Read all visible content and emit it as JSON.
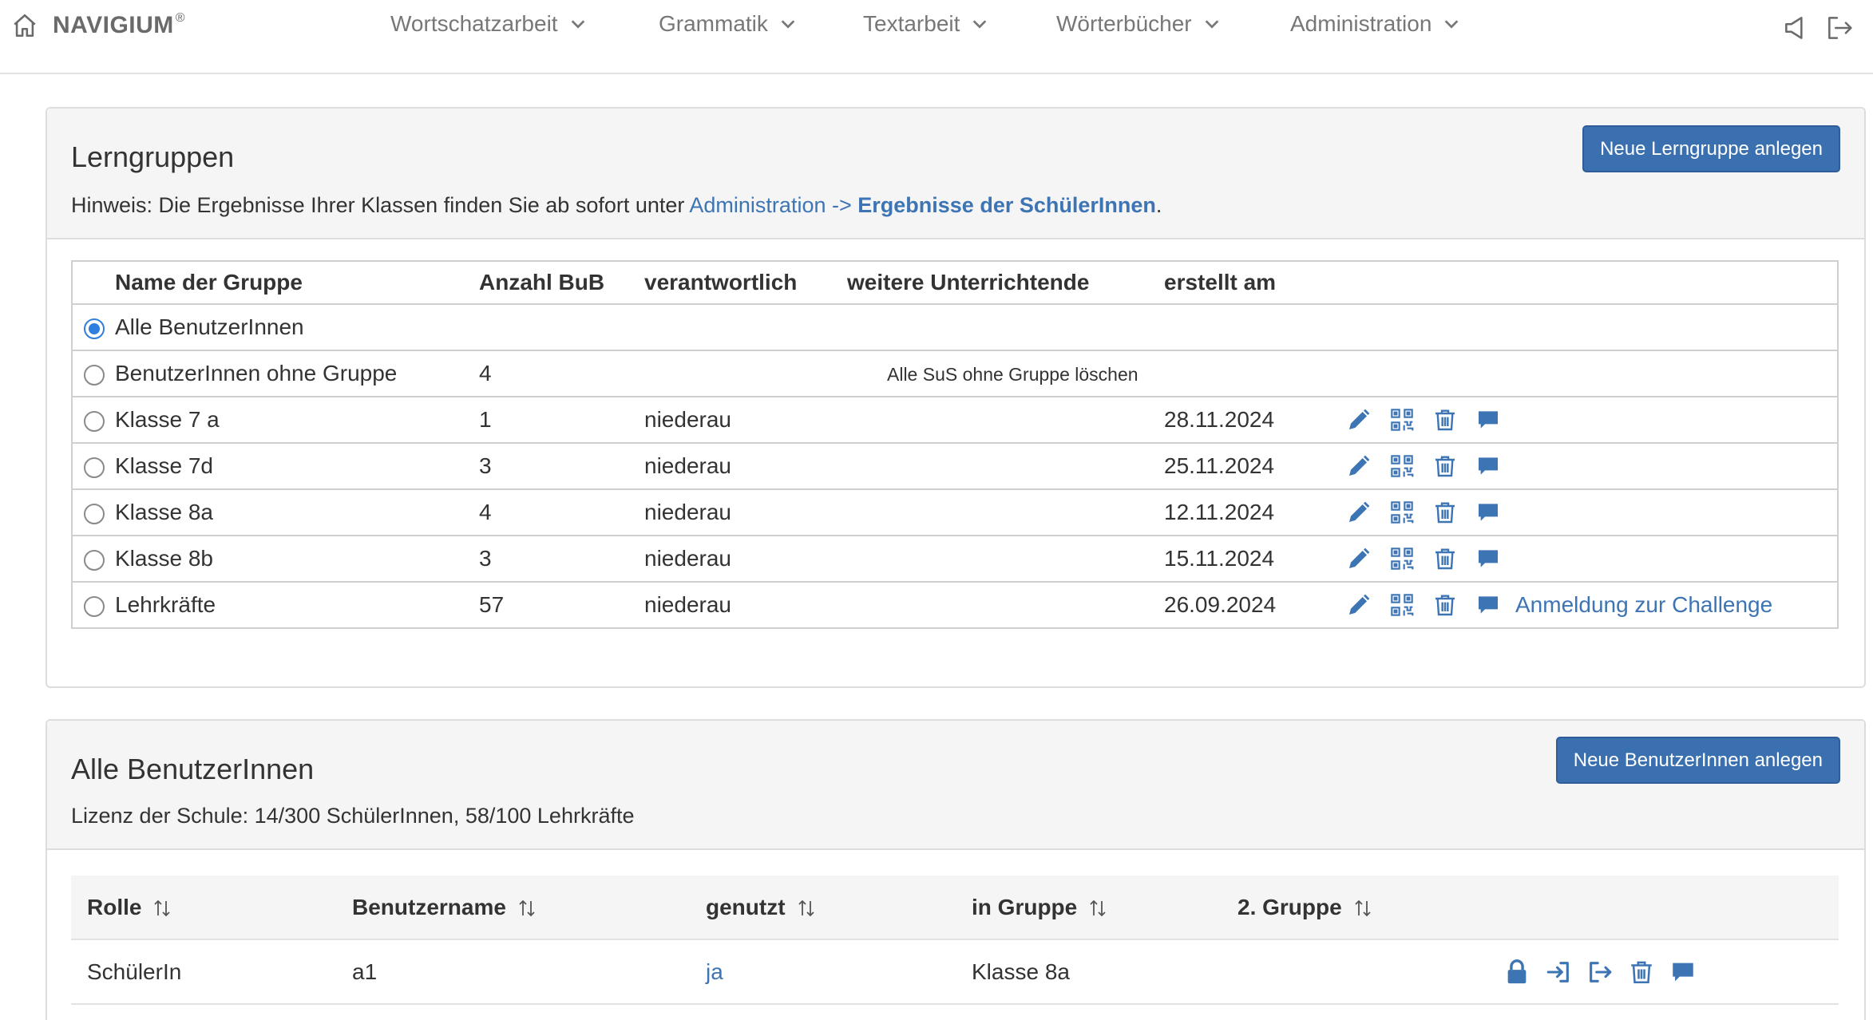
{
  "navbar": {
    "brand": "NAVIGIUM",
    "brand_mark": "®",
    "home_icon": "home-icon",
    "menu": [
      {
        "label": "Wortschatzarbeit"
      },
      {
        "label": "Grammatik"
      },
      {
        "label": "Textarbeit"
      },
      {
        "label": "Wörterbücher"
      },
      {
        "label": "Administration"
      }
    ],
    "right_icons": [
      "speaker-icon",
      "logout-icon"
    ]
  },
  "groups": {
    "title": "Lerngruppen",
    "new_button": "Neue Lerngruppe anlegen",
    "hint_prefix": "Hinweis: Die Ergebnisse Ihrer Klassen finden Sie ab sofort unter ",
    "hint_link1": "Administration ->",
    "hint_link2": "Ergebnisse der SchülerInnen",
    "hint_suffix": ".",
    "headers": {
      "name": "Name der Gruppe",
      "count": "Anzahl BuB",
      "responsible": "verantwortlich",
      "more_teachers": "weitere Unterrichtende",
      "created": "erstellt am"
    },
    "row_all": {
      "name": "Alle BenutzerInnen",
      "selected": true
    },
    "row_nogroup": {
      "name": "BenutzerInnen ohne Gruppe",
      "count": "4",
      "delete_text": "Alle SuS ohne Gruppe löschen"
    },
    "rows": [
      {
        "name": "Klasse 7 a",
        "count": "1",
        "responsible": "niederau",
        "created": "28.11.2024"
      },
      {
        "name": "Klasse 7d",
        "count": "3",
        "responsible": "niederau",
        "created": "25.11.2024"
      },
      {
        "name": "Klasse 8a",
        "count": "4",
        "responsible": "niederau",
        "created": "12.11.2024"
      },
      {
        "name": "Klasse 8b",
        "count": "3",
        "responsible": "niederau",
        "created": "15.11.2024"
      },
      {
        "name": "Lehrkräfte",
        "count": "57",
        "responsible": "niederau",
        "created": "26.09.2024"
      }
    ],
    "challenge_link": "Anmeldung zur Challenge",
    "action_icons": [
      "edit-icon",
      "qr-code-icon",
      "trash-icon",
      "message-icon"
    ],
    "accent_color": "#3d74b3"
  },
  "users": {
    "title": "Alle BenutzerInnen",
    "new_button": "Neue BenutzerInnen anlegen",
    "license": "Lizenz der Schule: 14/300 SchülerInnen, 58/100 Lehrkräfte",
    "headers": {
      "role": "Rolle",
      "username": "Benutzername",
      "used": "genutzt",
      "group": "in Gruppe",
      "group2": "2. Gruppe"
    },
    "rows": [
      {
        "role": "SchülerIn",
        "username": "a1",
        "used": "ja",
        "group": "Klasse 8a",
        "group2": ""
      }
    ],
    "row_icons": [
      "lock-icon",
      "login-as-icon",
      "move-group-icon",
      "trash-icon",
      "message-icon"
    ]
  }
}
